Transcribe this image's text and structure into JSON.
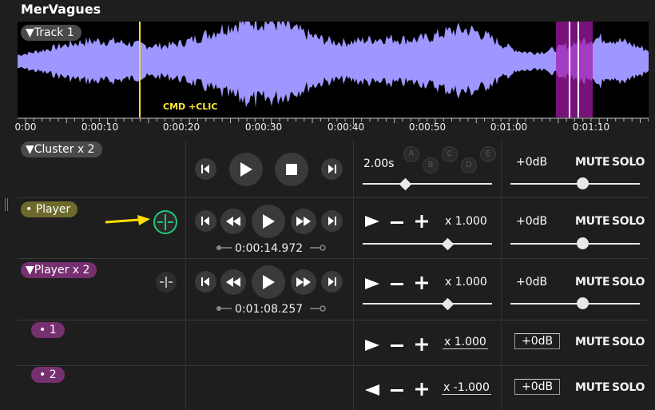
{
  "app": {
    "title": "MerVagues"
  },
  "waveform": {
    "track_label": "▼Track 1",
    "hint": "CMD +CLIC",
    "colors": {
      "wave": "#9d97ff",
      "cursor": "#f0e030",
      "selection": "#a419a8"
    }
  },
  "timeline": {
    "ticks": [
      "0:00",
      "0:00:10",
      "0:00:20",
      "0:00:30",
      "0:00:40",
      "0:00:50",
      "0:01:00",
      "0:01:10"
    ]
  },
  "cluster": {
    "label": "▼Cluster x 2",
    "duration": "2.00s",
    "presets": [
      "A",
      "B",
      "C",
      "D",
      "E"
    ],
    "gain": "+0dB",
    "mute": "MUTE",
    "solo": "SOLO",
    "duration_level": 0.33,
    "gain_level": 0.56
  },
  "player": {
    "label": "• Player",
    "time": "0:00:14.972",
    "speed": "x 1.000",
    "gain": "+0dB",
    "mute": "MUTE",
    "solo": "SOLO",
    "speed_level": 0.66,
    "gain_level": 0.56,
    "annotation_color": "#ffe000"
  },
  "player_x2": {
    "label": "▼Player x 2",
    "time": "0:01:08.257",
    "speed": "x 1.000",
    "gain": "+0dB",
    "mute": "MUTE",
    "solo": "SOLO",
    "speed_level": 0.66,
    "gain_level": 0.56
  },
  "sub_1": {
    "label": "• 1",
    "speed": "x 1.000",
    "gain": "+0dB",
    "mute": "MUTE",
    "solo": "SOLO"
  },
  "sub_2": {
    "label": "• 2",
    "speed": "x -1.000",
    "gain": "+0dB",
    "mute": "MUTE",
    "solo": "SOLO"
  }
}
